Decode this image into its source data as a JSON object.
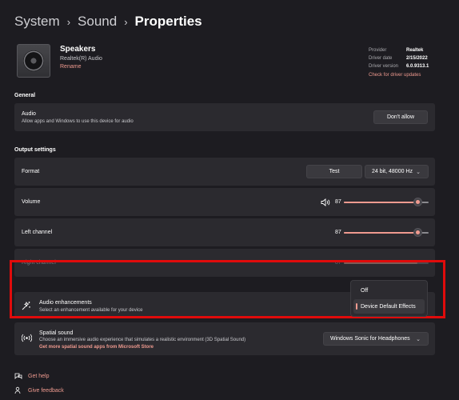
{
  "breadcrumb": {
    "items": [
      "System",
      "Sound",
      "Properties"
    ],
    "separator": "›"
  },
  "device": {
    "name": "Speakers",
    "subtitle": "Realtek(R) Audio",
    "rename_label": "Rename"
  },
  "driver": {
    "provider_label": "Provider",
    "provider_value": "Realtek",
    "date_label": "Driver date",
    "date_value": "2/15/2022",
    "version_label": "Driver version",
    "version_value": "6.0.9313.1",
    "update_link": "Check for driver updates"
  },
  "general": {
    "title": "General",
    "audio_label": "Audio",
    "audio_desc": "Allow apps and Windows to use this device for audio",
    "dont_allow_label": "Don't allow"
  },
  "output": {
    "title": "Output settings",
    "format_label": "Format",
    "test_label": "Test",
    "format_value": "24 bit, 48000 Hz",
    "volume_label": "Volume",
    "volume_value": "87",
    "left_channel_label": "Left channel",
    "left_channel_value": "87",
    "right_channel_label": "Right channel",
    "right_channel_value": "87",
    "enhancements_label": "Audio enhancements",
    "enhancements_desc": "Select an enhancement available for your device",
    "enhancement_options": [
      "Off",
      "Device Default Effects"
    ],
    "enhancement_selected": "Device Default Effects",
    "spatial_label": "Spatial sound",
    "spatial_desc": "Choose an immersive audio experience that simulates a realistic environment (3D Spatial Sound)",
    "spatial_link": "Get more spatial sound apps from Microsoft Store",
    "spatial_value": "Windows Sonic for Headphones"
  },
  "footer": {
    "help_label": "Get help",
    "feedback_label": "Give feedback"
  },
  "colors": {
    "accent": "#ef9a8f",
    "highlight_box": "#e00b0b",
    "background": "#1d1c21",
    "card": "#2b2a2f"
  },
  "icons": [
    "speaker-device-icon",
    "volume-icon",
    "enhancement-icon",
    "spatial-sound-icon",
    "help-icon",
    "feedback-icon",
    "chevron-down-icon",
    "chevron-right-icon"
  ]
}
